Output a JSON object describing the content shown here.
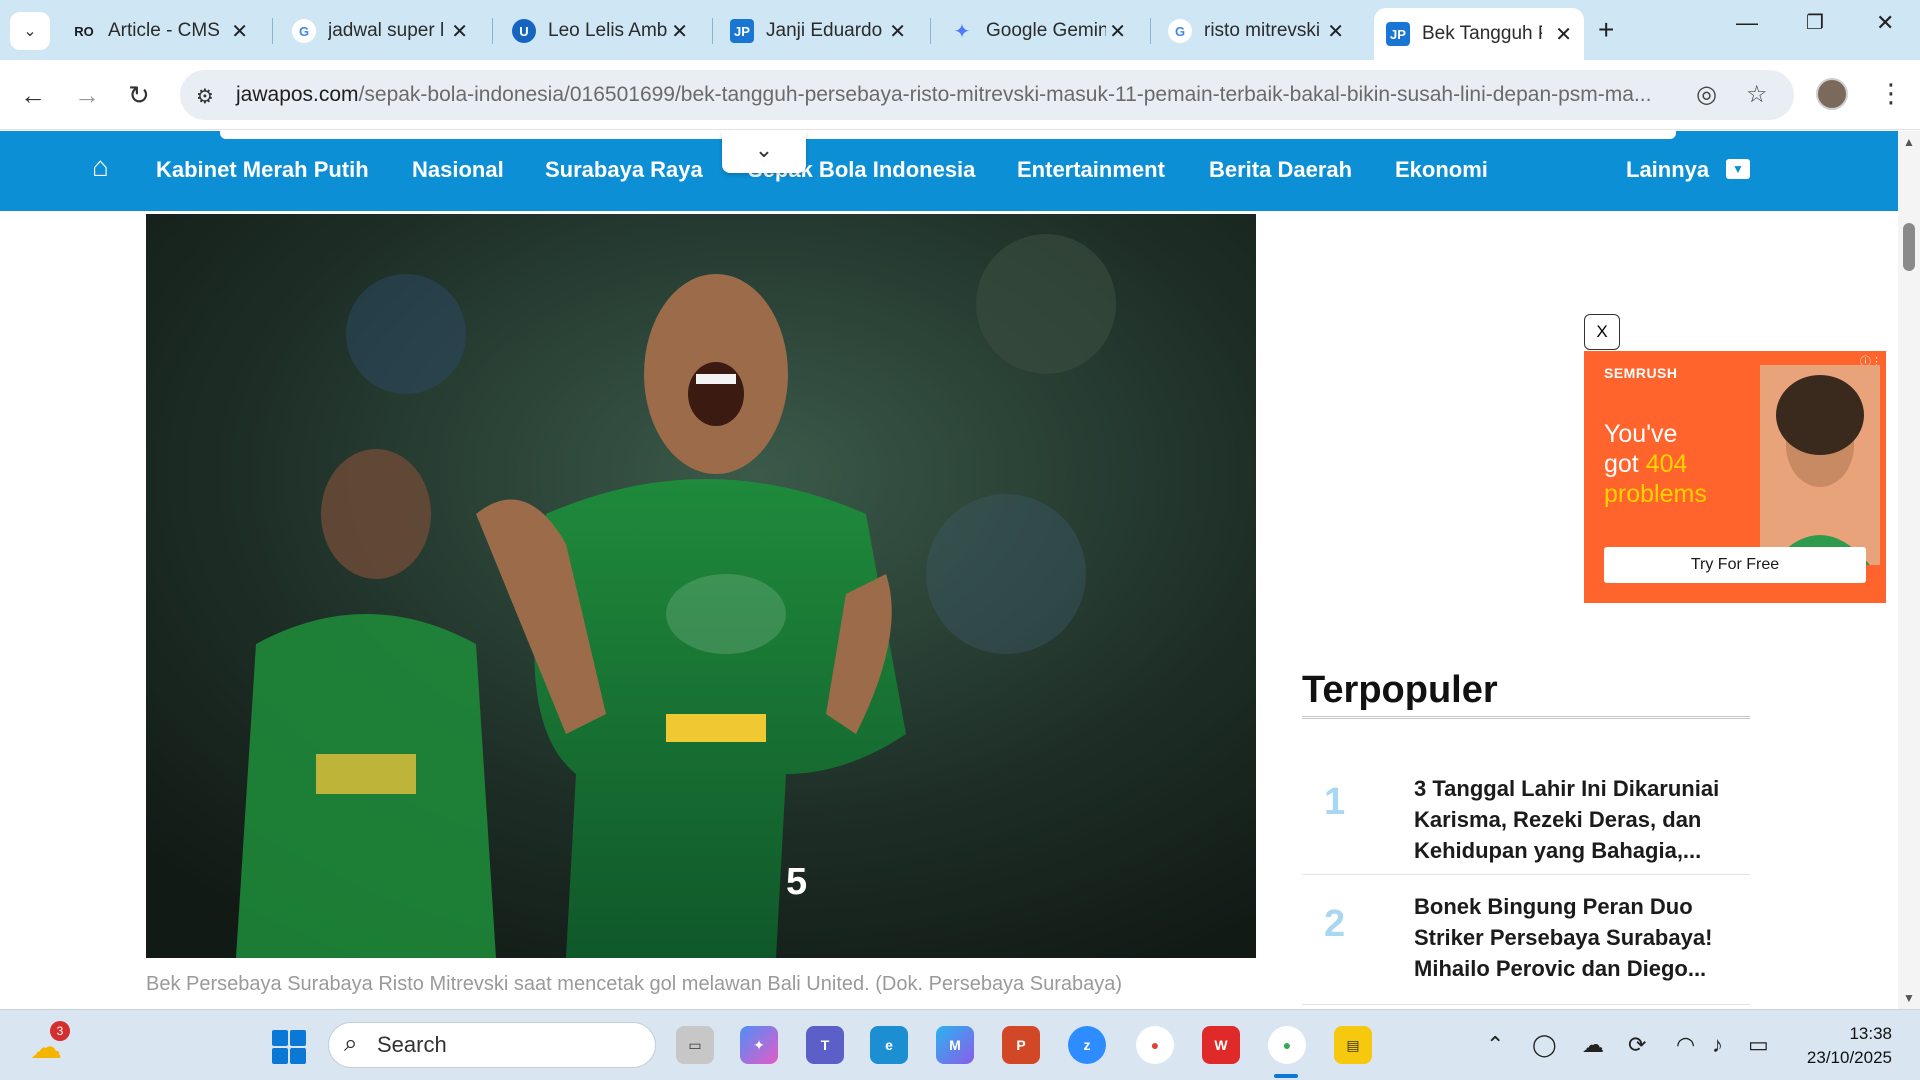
{
  "tabs": [
    {
      "title": "Article - CMS",
      "fav": "RO",
      "color": "#2b2b2b"
    },
    {
      "title": "jadwal super l",
      "fav": "G",
      "color": "#4285f4"
    },
    {
      "title": "Leo Lelis Amb",
      "fav": "U",
      "color": "#1565c0"
    },
    {
      "title": "Janji Eduardo",
      "fav": "JP",
      "color": "#1976d2"
    },
    {
      "title": "Google Gemin",
      "fav": "✦",
      "color": "#4e7cf6"
    },
    {
      "title": "risto mitrevski",
      "fav": "G",
      "color": "#4285f4"
    },
    {
      "title": "Bek Tangguh P",
      "fav": "JP",
      "color": "#1976d2"
    }
  ],
  "address": {
    "domain": "jawapos.com",
    "path": "/sepak-bola-indonesia/016501699/bek-tangguh-persebaya-risto-mitrevski-masuk-11-pemain-terbaik-bakal-bikin-susah-lini-depan-psm-ma..."
  },
  "nav": {
    "items": [
      "Kabinet Merah Putih",
      "Nasional",
      "Surabaya Raya",
      "Sepak Bola Indonesia",
      "Entertainment",
      "Berita Daerah",
      "Ekonomi"
    ],
    "more": "Lainnya"
  },
  "article": {
    "caption": "Bek Persebaya Surabaya Risto Mitrevski saat mencetak gol melawan Bali United. (Dok. Persebaya Surabaya)"
  },
  "ad": {
    "close": "X",
    "brand": "SEMRUSH",
    "line1": "You've",
    "line2a": "got ",
    "line2b": "404",
    "line3": "problems",
    "cta": "Try For Free"
  },
  "popular": {
    "title": "Terpopuler",
    "items": [
      {
        "rank": "1",
        "text": "3 Tanggal Lahir Ini Dikaruniai Karisma, Rezeki Deras, dan Kehidupan yang Bahagia,..."
      },
      {
        "rank": "2",
        "text": "Bonek Bingung Peran Duo Striker Persebaya Surabaya! Mihailo Perovic dan Diego..."
      }
    ]
  },
  "taskbar": {
    "search_label": "Search",
    "weather_badge": "3",
    "time": "13:38",
    "date": "23/10/2025"
  },
  "colors": {
    "brand_blue": "#0d8fd6",
    "ad_orange": "#ff642d",
    "rank_blue": "#a8d6f3"
  }
}
